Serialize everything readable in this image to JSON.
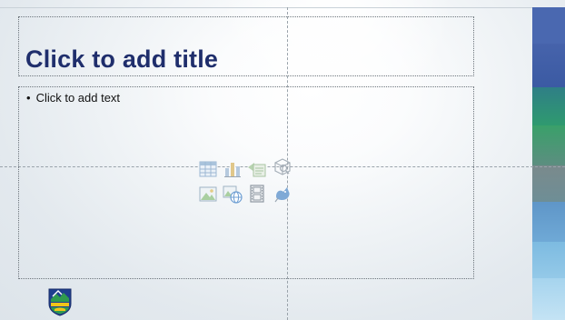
{
  "slide": {
    "title_placeholder": "Click to add title",
    "body_placeholder": "Click to add text",
    "bullet": "•"
  },
  "insert_icons": [
    {
      "name": "insert-table-icon"
    },
    {
      "name": "insert-chart-icon"
    },
    {
      "name": "insert-smartart-icon"
    },
    {
      "name": "insert-3d-model-icon"
    },
    {
      "name": "insert-picture-icon"
    },
    {
      "name": "insert-online-picture-icon"
    },
    {
      "name": "insert-video-icon"
    },
    {
      "name": "insert-icons-icon"
    }
  ],
  "theme": {
    "title_color": "#1f2e6c",
    "band_colors": [
      "#4c6fb3",
      "#3f5ea8",
      "#2e8a7e",
      "#3fa36f",
      "#6e8f87",
      "#7d8a8e",
      "#6aa0cf",
      "#8cc3e4",
      "#b9dcf1"
    ]
  }
}
